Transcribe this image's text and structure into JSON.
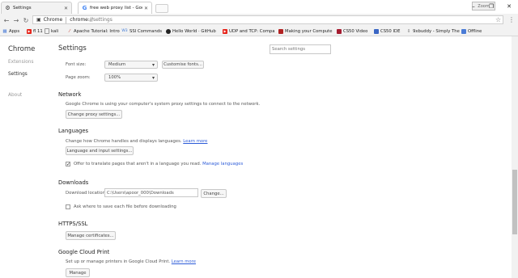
{
  "window": {
    "tabs": [
      {
        "label": "Settings",
        "icon": "gear-icon"
      },
      {
        "label": "free web proxy list - Goo",
        "icon": "google-icon"
      }
    ],
    "user": "Zoom",
    "minimize": "–",
    "maximize": "❐",
    "close": "✕"
  },
  "toolbar": {
    "back": "←",
    "forward": "→",
    "reload": "↻",
    "site_label": "Chrome",
    "url_scheme": "chrome://",
    "url_path": "settings",
    "star": "☆",
    "menu": "⋮"
  },
  "bookmarks": [
    {
      "label": "Apps",
      "icon": "apps-grid-icon",
      "color": "#4a7bd6"
    },
    {
      "label": "fl 11",
      "icon": "youtube-icon",
      "color": "#e62117"
    },
    {
      "label": "kali",
      "icon": "page-icon",
      "color": "#888888"
    },
    {
      "label": "Apache Tutorial: Intro",
      "icon": "feather-icon",
      "color": "#c0392b"
    },
    {
      "label": "SSI Commands",
      "icon": "w3schools-icon",
      "color": "#3e7ad6"
    },
    {
      "label": "Hello World · GitHub",
      "icon": "github-icon",
      "color": "#222222"
    },
    {
      "label": "UDP and TCP: Compa",
      "icon": "youtube-icon",
      "color": "#e62117"
    },
    {
      "label": "Making your Compute",
      "icon": "bookmark-icon",
      "color": "#b22222"
    },
    {
      "label": "CS50 Video",
      "icon": "harvard-icon",
      "color": "#a51c30"
    },
    {
      "label": "CS50 IDE",
      "icon": "cs50-icon",
      "color": "#3a66c4"
    },
    {
      "label": "9xbuddy - Simply The",
      "icon": "download-icon",
      "color": "#555555"
    },
    {
      "label": "Offline",
      "icon": "folder-icon",
      "color": "#4a7bd6"
    }
  ],
  "sidebar": {
    "title": "Chrome",
    "items": [
      {
        "label": "Extensions"
      },
      {
        "label": "Settings"
      },
      {
        "label": "About"
      }
    ]
  },
  "main": {
    "title": "Settings",
    "search_placeholder": "Search settings",
    "font_size_label": "Font size:",
    "font_size_value": "Medium",
    "customise_fonts": "Customise fonts...",
    "page_zoom_label": "Page zoom:",
    "page_zoom_value": "100%",
    "network": {
      "heading": "Network",
      "desc": "Google Chrome is using your computer's system proxy settings to connect to the network.",
      "button": "Change proxy settings..."
    },
    "languages": {
      "heading": "Languages",
      "desc": "Change how Chrome handles and displays languages.",
      "learn_more": "Learn more",
      "button": "Language and input settings...",
      "offer_translate": "Offer to translate pages that aren't in a language you read.",
      "manage_languages": "Manage languages",
      "offer_checked": true
    },
    "downloads": {
      "heading": "Downloads",
      "location_label": "Download location:",
      "location_value": "C:\\Users\\apoor_000\\Downloads",
      "change": "Change...",
      "ask_where": "Ask where to save each file before downloading",
      "ask_checked": false
    },
    "https": {
      "heading": "HTTPS/SSL",
      "button": "Manage certificates..."
    },
    "cloud_print": {
      "heading": "Google Cloud Print",
      "desc": "Set up or manage printers in Google Cloud Print.",
      "learn_more": "Learn more",
      "button": "Manage"
    }
  },
  "colors": {
    "link": "#2c5bd8",
    "sidebar_selected": "#333333",
    "sidebar_unselected": "#999999"
  }
}
